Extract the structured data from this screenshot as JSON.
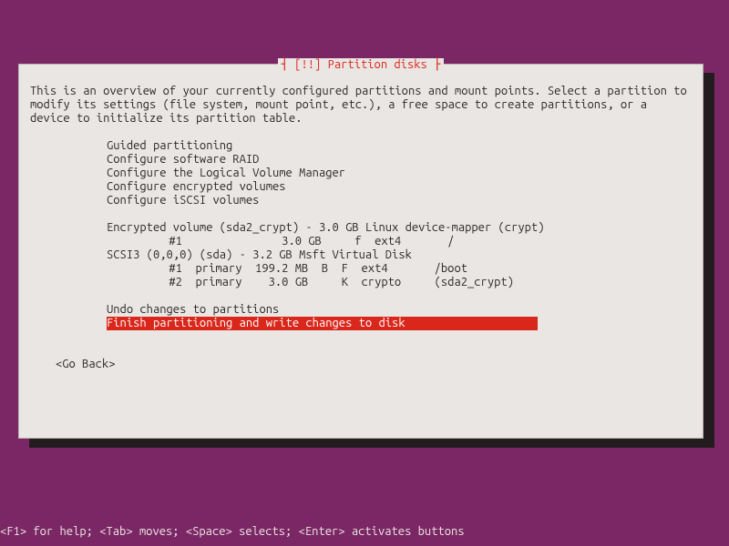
{
  "dialog": {
    "title": "┤ [!!] Partition disks ├",
    "description": "This is an overview of your currently configured partitions and mount points. Select a partition to modify its settings (file system, mount point, etc.), a free space to create partitions, or a device to initialize its partition table.",
    "menu": {
      "guided": "Guided partitioning",
      "raid": "Configure software RAID",
      "lvm": "Configure the Logical Volume Manager",
      "encrypted": "Configure encrypted volumes",
      "iscsi": "Configure iSCSI volumes",
      "enc_vol": "Encrypted volume (sda2_crypt) - 3.0 GB Linux device-mapper (crypt)",
      "enc_part1": "     #1               3.0 GB     f  ext4       /",
      "scsi": "SCSI3 (0,0,0) (sda) - 3.2 GB Msft Virtual Disk",
      "scsi_part1": "     #1  primary  199.2 MB  B  F  ext4       /boot",
      "scsi_part2": "     #2  primary    3.0 GB     K  crypto     (sda2_crypt)",
      "undo": "Undo changes to partitions",
      "finish": "Finish partitioning and write changes to disk                    "
    },
    "goback": "<Go Back>"
  },
  "footer": "<F1> for help; <Tab> moves; <Space> selects; <Enter> activates buttons"
}
